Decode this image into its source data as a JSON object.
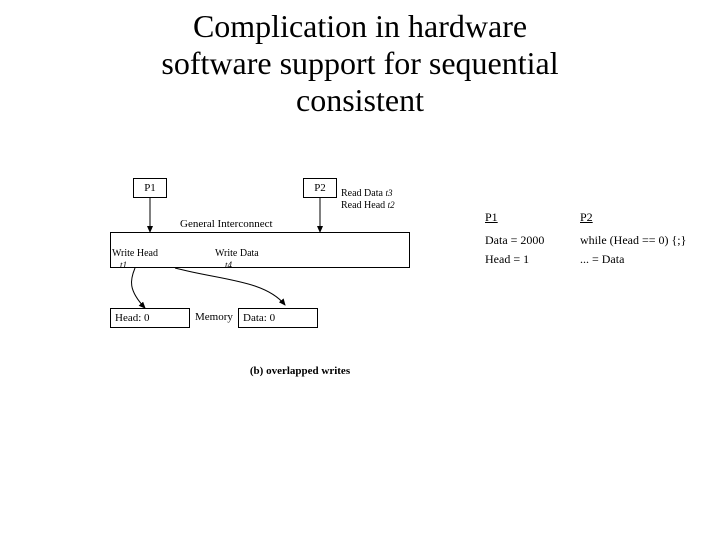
{
  "title_line1": "Complication in hardware",
  "title_line2": "software support for sequential",
  "title_line3": "consistent",
  "p1": "P1",
  "p2": "P2",
  "interconnect": "General Interconnect",
  "read_data": "Read Data",
  "read_head": "Read Head",
  "t1": "t1",
  "t2": "t2",
  "t3": "t3",
  "t4": "t4",
  "write_head": "Write Head",
  "write_data": "Write Data",
  "mem_head": "Head: 0",
  "mem_data": "Data: 0",
  "memory": "Memory",
  "caption": "(b) overlapped writes",
  "code_p1": "P1",
  "code_p2": "P2",
  "code_p1_l1": "Data = 2000",
  "code_p1_l2": "Head = 1",
  "code_p2_l1": "while (Head == 0) {;}",
  "code_p2_l2": "... = Data"
}
